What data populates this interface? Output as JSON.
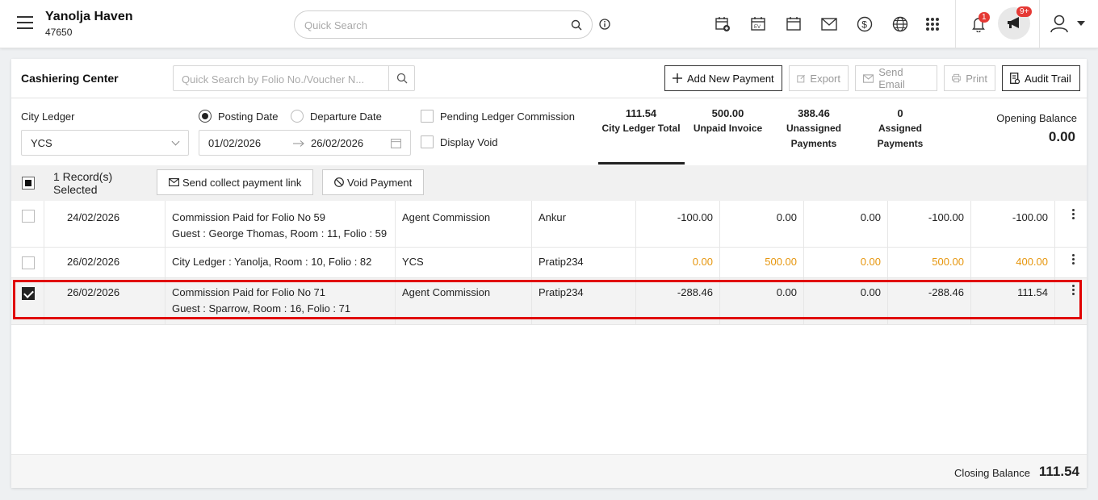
{
  "header": {
    "hotel_name": "Yanolja Haven",
    "hotel_id": "47650",
    "search_placeholder": "Quick Search",
    "notification_count": "1",
    "announcement_count": "9+"
  },
  "toolbar": {
    "title": "Cashiering Center",
    "folio_search_placeholder": "Quick Search by Folio No./Voucher N...",
    "add_payment": "Add New Payment",
    "export": "Export",
    "send_email": "Send Email",
    "print": "Print",
    "audit_trail": "Audit Trail"
  },
  "filters": {
    "ledger_label": "City Ledger",
    "ledger_value": "YCS",
    "posting_date": "Posting Date",
    "departure_date": "Departure Date",
    "date_from": "01/02/2026",
    "date_to": "26/02/2026",
    "pending_commission": "Pending Ledger Commission",
    "display_void": "Display Void"
  },
  "stats": {
    "city_ledger_total_value": "111.54",
    "city_ledger_total_label": "City Ledger Total",
    "unpaid_invoice_value": "500.00",
    "unpaid_invoice_label": "Unpaid Invoice",
    "unassigned_value": "388.46",
    "unassigned_label_1": "Unassigned",
    "unassigned_label_2": "Payments",
    "assigned_value": "0",
    "assigned_label": "Assigned Payments",
    "opening_balance_label": "Opening Balance",
    "opening_balance_value": "0.00"
  },
  "selection": {
    "records_line1": "1 Record(s)",
    "records_line2": "Selected",
    "send_link": "Send collect payment link",
    "void_payment": "Void Payment"
  },
  "rows": [
    {
      "date": "24/02/2026",
      "desc1": "Commission Paid for Folio No 59",
      "desc2": "Guest : George Thomas, Room : 11, Folio : 59",
      "type": "Agent Commission",
      "user": "Ankur",
      "v1": "-100.00",
      "v2": "0.00",
      "v3": "0.00",
      "v4": "-100.00",
      "v5": "-100.00"
    },
    {
      "date": "26/02/2026",
      "desc1": "City Ledger : Yanolja, Room : 10, Folio : 82",
      "desc2": "",
      "type": "YCS",
      "user": "Pratip234",
      "v1": "0.00",
      "v2": "500.00",
      "v3": "0.00",
      "v4": "500.00",
      "v5": "400.00"
    },
    {
      "date": "26/02/2026",
      "desc1": "Commission Paid for Folio No 71",
      "desc2": "Guest : Sparrow, Room : 16, Folio : 71",
      "type": "Agent Commission",
      "user": "Pratip234",
      "v1": "-288.46",
      "v2": "0.00",
      "v3": "0.00",
      "v4": "-288.46",
      "v5": "111.54"
    }
  ],
  "footer": {
    "closing_label": "Closing Balance",
    "closing_value": "111.54"
  },
  "colors": {
    "accent_orange": "#e6960e",
    "highlight_red": "#e00000",
    "badge_red": "#e53935"
  }
}
